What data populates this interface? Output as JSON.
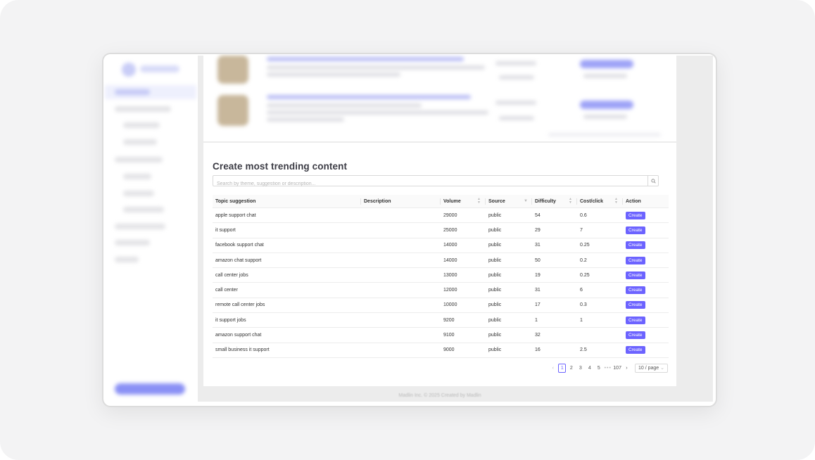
{
  "section_title": "Create most trending content",
  "search": {
    "placeholder": "Search by theme, suggestion or description..."
  },
  "columns": [
    "Topic suggestion",
    "Description",
    "Volume",
    "Source",
    "Difficulty",
    "Cost/click",
    "Action"
  ],
  "rows": [
    {
      "topic": "apple support chat",
      "description": "",
      "volume": "29000",
      "source": "public",
      "difficulty": "54",
      "cpc": "0.6",
      "action": "Create"
    },
    {
      "topic": "it support",
      "description": "",
      "volume": "25000",
      "source": "public",
      "difficulty": "29",
      "cpc": "7",
      "action": "Create"
    },
    {
      "topic": "facebook support chat",
      "description": "",
      "volume": "14000",
      "source": "public",
      "difficulty": "31",
      "cpc": "0.25",
      "action": "Create"
    },
    {
      "topic": "amazon chat support",
      "description": "",
      "volume": "14000",
      "source": "public",
      "difficulty": "50",
      "cpc": "0.2",
      "action": "Create"
    },
    {
      "topic": "call center jobs",
      "description": "",
      "volume": "13000",
      "source": "public",
      "difficulty": "19",
      "cpc": "0.25",
      "action": "Create"
    },
    {
      "topic": "call center",
      "description": "",
      "volume": "12000",
      "source": "public",
      "difficulty": "31",
      "cpc": "6",
      "action": "Create"
    },
    {
      "topic": "remote call center jobs",
      "description": "",
      "volume": "10000",
      "source": "public",
      "difficulty": "17",
      "cpc": "0.3",
      "action": "Create"
    },
    {
      "topic": "it support jobs",
      "description": "",
      "volume": "9200",
      "source": "public",
      "difficulty": "1",
      "cpc": "1",
      "action": "Create"
    },
    {
      "topic": "amazon support chat",
      "description": "",
      "volume": "9100",
      "source": "public",
      "difficulty": "32",
      "cpc": "",
      "action": "Create"
    },
    {
      "topic": "small business it support",
      "description": "",
      "volume": "9000",
      "source": "public",
      "difficulty": "16",
      "cpc": "2.5",
      "action": "Create"
    }
  ],
  "pagination": {
    "pages": [
      "1",
      "2",
      "3",
      "4",
      "5"
    ],
    "dots": "•••",
    "last": "107",
    "page_size": "10 / page"
  },
  "footer": "Madlin Inc. © 2025 Created by Madlin",
  "colors": {
    "accent": "#6c63ff"
  }
}
